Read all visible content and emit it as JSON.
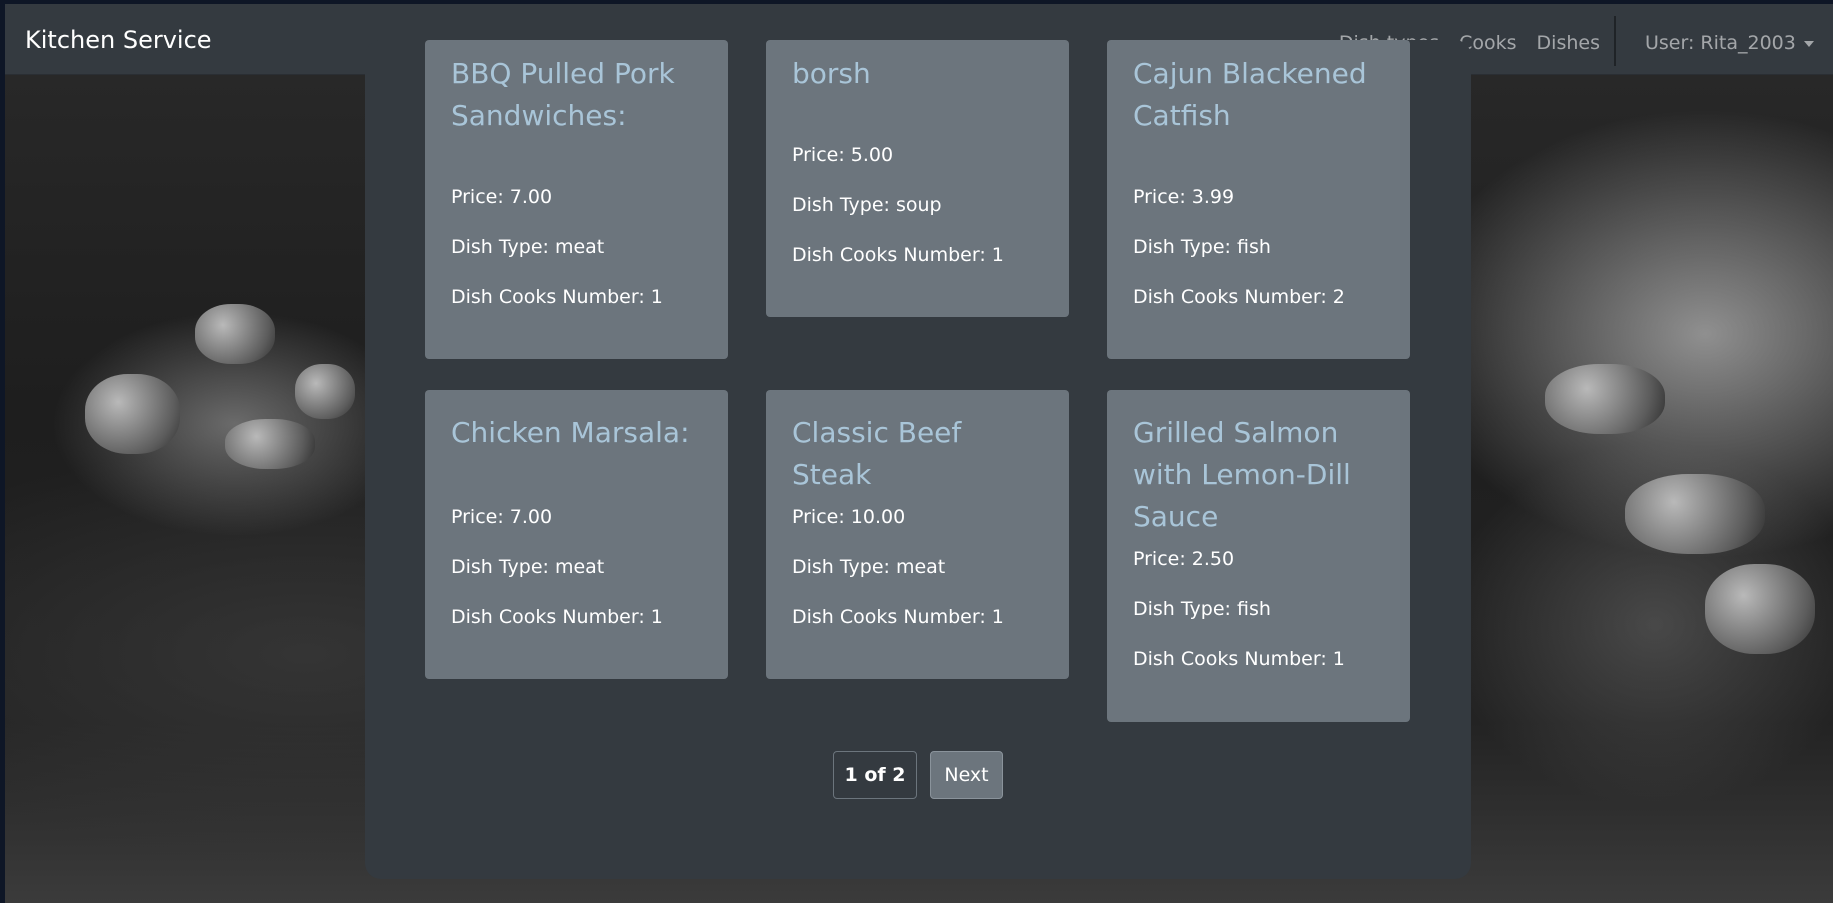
{
  "navbar": {
    "brand": "Kitchen Service",
    "links": [
      "Dish types",
      "Cooks",
      "Dishes"
    ],
    "user": "User: Rita_2003"
  },
  "dishes": [
    {
      "name": "BBQ Pulled Pork Sandwiches:",
      "price": "Price: 7.00",
      "type": "Dish Type: meat",
      "cooks": "Dish Cooks Number: 1"
    },
    {
      "name": "borsh",
      "price": "Price: 5.00",
      "type": "Dish Type: soup",
      "cooks": "Dish Cooks Number: 1"
    },
    {
      "name": "Cajun Blackened Catfish",
      "price": "Price: 3.99",
      "type": "Dish Type: fish",
      "cooks": "Dish Cooks Number: 2"
    },
    {
      "name": "Chicken Marsala:",
      "price": "Price: 7.00",
      "type": "Dish Type: meat",
      "cooks": "Dish Cooks Number: 1"
    },
    {
      "name": "Classic Beef Steak",
      "price": "Price: 10.00",
      "type": "Dish Type: meat",
      "cooks": "Dish Cooks Number: 1"
    },
    {
      "name": "Grilled Salmon with Lemon-Dill Sauce",
      "price": "Price: 2.50",
      "type": "Dish Type: fish",
      "cooks": "Dish Cooks Number: 1"
    }
  ],
  "pagination": {
    "current": "1 of 2",
    "next": "Next"
  }
}
